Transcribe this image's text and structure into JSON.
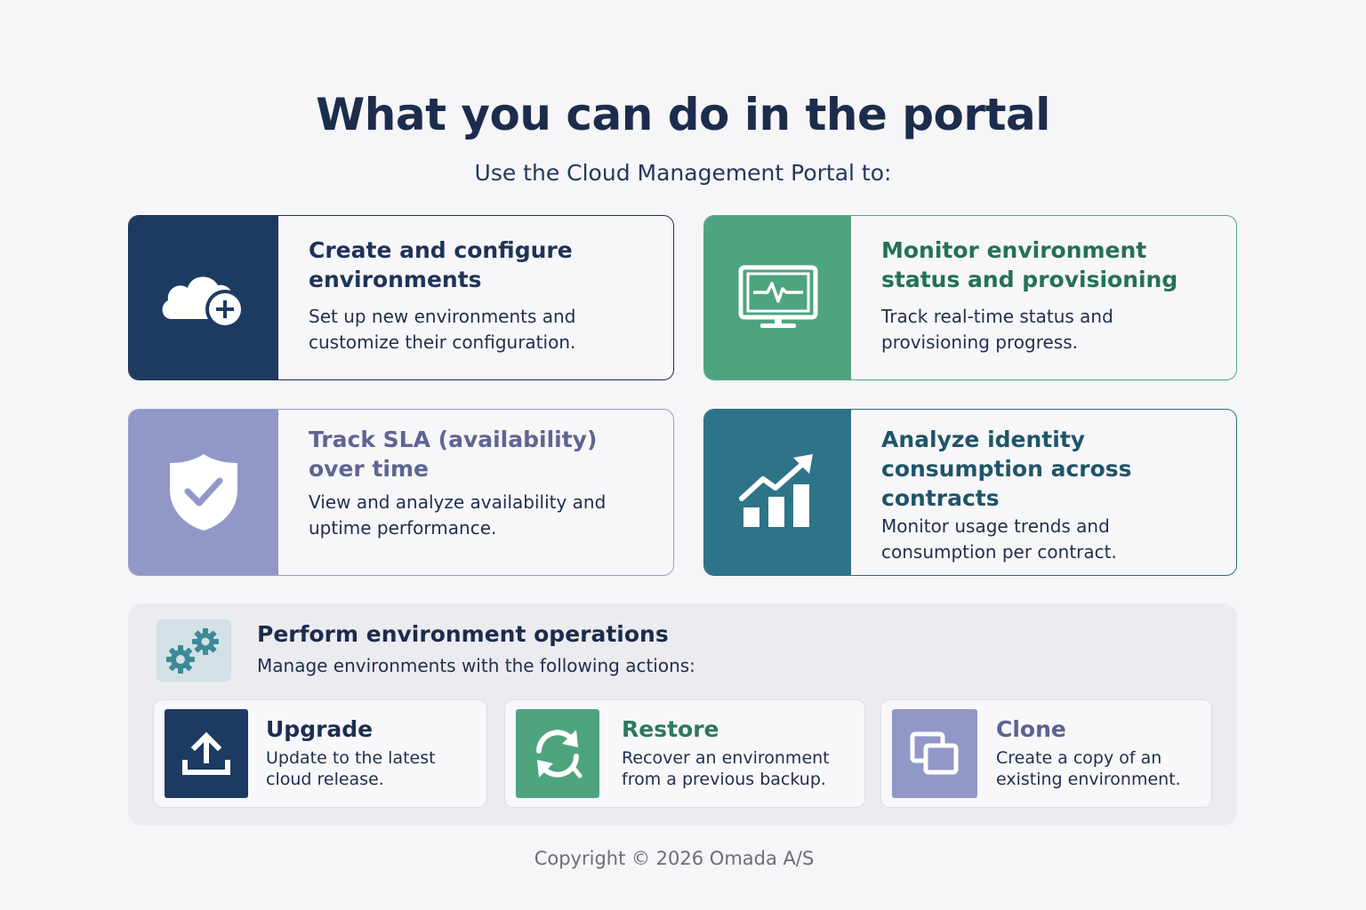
{
  "header": {
    "title": "What you can do in the portal",
    "subtitle": "Use the Cloud Management Portal to:"
  },
  "features": [
    {
      "title_line1": "Create and configure",
      "title_line2": "environments",
      "desc_line1": "Set up new environments and",
      "desc_line2": "customize their configuration.",
      "icon": "cloud-add-icon"
    },
    {
      "title_line1": "Monitor environment",
      "title_line2": "status and provisioning",
      "desc_line1": "Track real-time status and",
      "desc_line2": "provisioning progress.",
      "icon": "monitor-pulse-icon"
    },
    {
      "title_line1": "Track SLA (availability)",
      "title_line2": "over time",
      "desc_line1": "View and analyze availability and",
      "desc_line2": "uptime performance.",
      "icon": "shield-check-icon"
    },
    {
      "title_line1": "Analyze identity",
      "title_line2": "consumption across",
      "title_line3": "contracts",
      "desc_line1": "Monitor usage trends and",
      "desc_line2": "consumption per contract.",
      "icon": "growth-chart-icon"
    }
  ],
  "operations": {
    "title": "Perform environment operations",
    "desc": "Manage environments with the following actions:",
    "icon": "gears-icon",
    "actions": [
      {
        "title": "Upgrade",
        "desc_line1": "Update to the latest",
        "desc_line2": "cloud release.",
        "icon": "upload-icon"
      },
      {
        "title": "Restore",
        "desc_line1": "Recover an environment",
        "desc_line2": "from a previous backup.",
        "icon": "restore-icon"
      },
      {
        "title": "Clone",
        "desc_line1": "Create a copy of an",
        "desc_line2": "existing environment.",
        "icon": "copy-icon"
      }
    ]
  },
  "footer": {
    "copyright": "Copyright © 2026 Omada A/S"
  },
  "colors": {
    "navy": "#1d3a62",
    "green": "#4ea47f",
    "lavender": "#9198c8",
    "teal": "#2e7488"
  }
}
